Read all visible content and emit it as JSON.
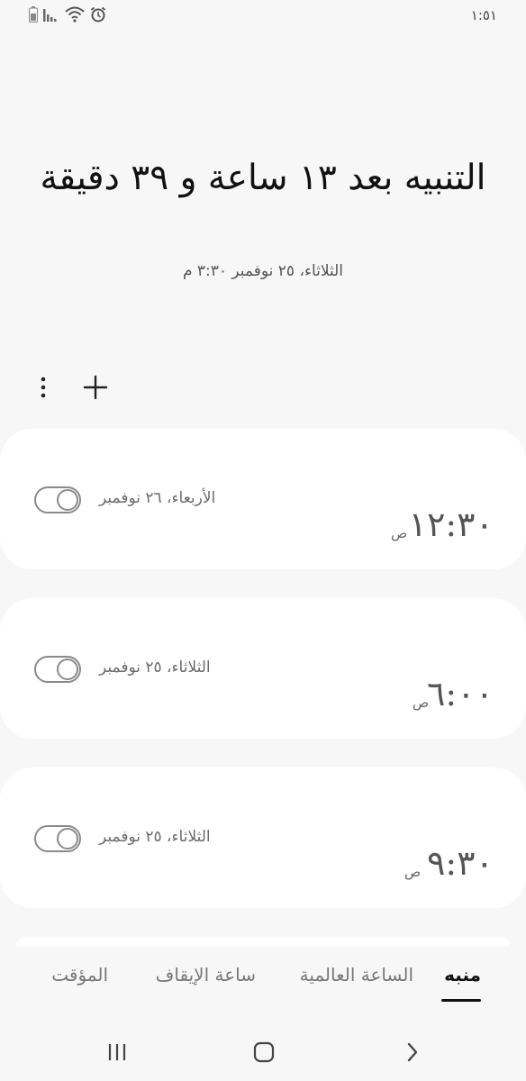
{
  "status_bar": {
    "time": "١:٥١",
    "icons": [
      "battery-icon",
      "signal-icon",
      "wifi-icon",
      "alarm-clock-icon"
    ]
  },
  "header": {
    "title": "التنبيه بعد ١٣ ساعة و ٣٩ دقيقة",
    "subtitle": "الثلاثاء، ٢٥ نوفمبر ٣:٣٠ م"
  },
  "toolbar": {
    "icons": [
      "more-options-icon",
      "add-icon"
    ]
  },
  "alarms": [
    {
      "time": "١٢:٣٠",
      "ampm": "ص",
      "date": "الأربعاء، ٢٦ نوفمبر",
      "enabled": false
    },
    {
      "time": "٦:٠٠",
      "ampm": "ص",
      "date": "الثلاثاء، ٢٥ نوفمبر",
      "enabled": false
    },
    {
      "time": "٩:٣٠",
      "ampm": "ص",
      "date": "الثلاثاء، ٢٥ نوفمبر",
      "enabled": false
    }
  ],
  "tabs": [
    {
      "label": "منبه",
      "active": true
    },
    {
      "label": "الساعة العالمية",
      "active": false
    },
    {
      "label": "ساعة الإيقاف",
      "active": false
    },
    {
      "label": "المؤقت",
      "active": false
    }
  ],
  "navbar": {
    "icons": [
      "recent-apps-icon",
      "home-icon",
      "back-icon"
    ]
  }
}
